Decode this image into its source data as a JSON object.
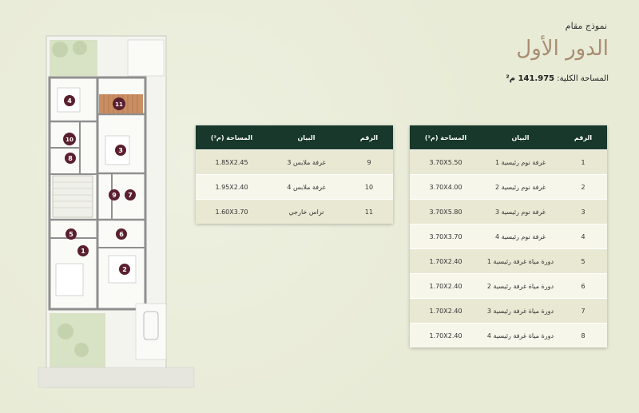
{
  "header": {
    "model_label": "نموذج مقام",
    "floor_title": "الدور الأول",
    "total_area_label": "المساحة الكلية:",
    "total_area_value": "141.975 م²"
  },
  "columns": {
    "num": "الرقم",
    "desc": "البيان",
    "area": "المساحة (م²)"
  },
  "table_main": [
    {
      "num": "1",
      "desc": "غرفة نوم رئيسية 1",
      "area": "3.70X5.50"
    },
    {
      "num": "2",
      "desc": "غرفة نوم رئيسية 2",
      "area": "3.70X4.00"
    },
    {
      "num": "3",
      "desc": "غرفة نوم رئيسية 3",
      "area": "3.70X5.80"
    },
    {
      "num": "4",
      "desc": "غرفة نوم رئيسية 4",
      "area": "3.70X3.70"
    },
    {
      "num": "5",
      "desc": "دورة مياة غرفة رئيسية 1",
      "area": "1.70X2.40"
    },
    {
      "num": "6",
      "desc": "دورة مياة غرفة رئيسية 2",
      "area": "1.70X2.40"
    },
    {
      "num": "7",
      "desc": "دورة مياة غرفة رئيسية 3",
      "area": "1.70X2.40"
    },
    {
      "num": "8",
      "desc": "دورة مياة غرفة رئيسية 4",
      "area": "1.70X2.40"
    }
  ],
  "table_side": [
    {
      "num": "9",
      "desc": "غرفة ملابس 3",
      "area": "1.85X2.45"
    },
    {
      "num": "10",
      "desc": "غرفة ملابس 4",
      "area": "1.95X2.40"
    },
    {
      "num": "11",
      "desc": "تراس خارجي",
      "area": "1.60X3.70"
    }
  ],
  "plan_labels": [
    "1",
    "2",
    "3",
    "4",
    "5",
    "6",
    "7",
    "8",
    "9",
    "10",
    "11"
  ],
  "colors": {
    "header_bg": "#17382b",
    "title": "#a88c71",
    "marker": "#5a1f2e",
    "wall": "#9a9a9a"
  }
}
